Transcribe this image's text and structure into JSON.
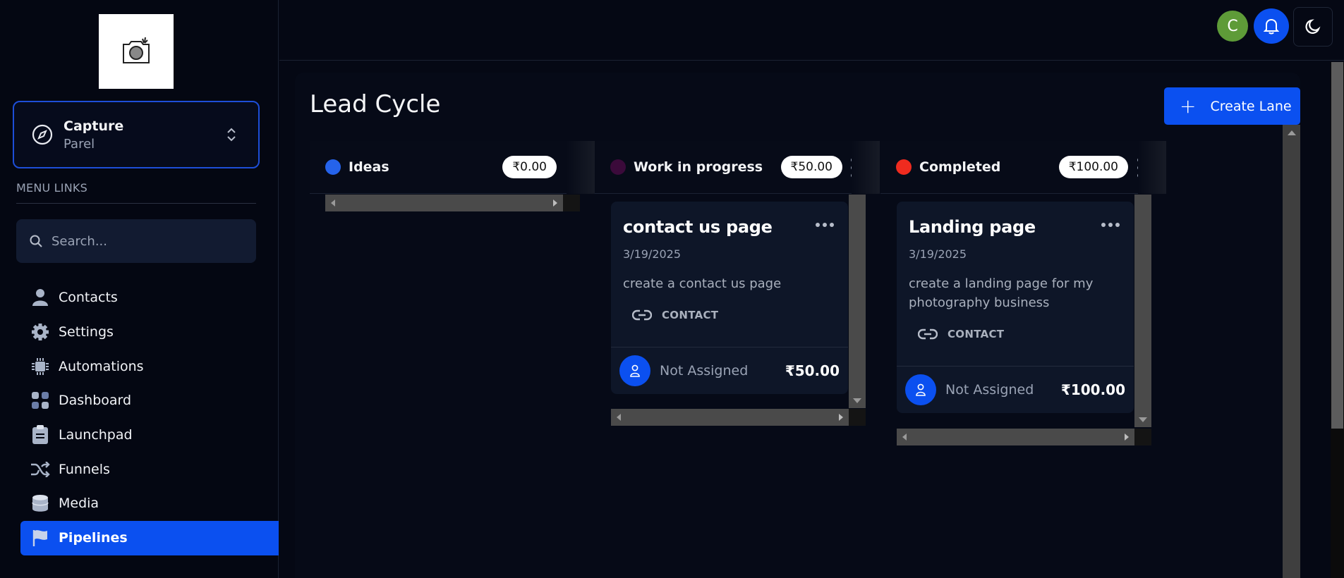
{
  "sidebar": {
    "account": {
      "name": "Capture",
      "location": "Parel"
    },
    "menu_label": "MENU LINKS",
    "search_placeholder": "Search...",
    "items": [
      {
        "label": "Contacts",
        "icon": "user-icon"
      },
      {
        "label": "Settings",
        "icon": "gear-icon"
      },
      {
        "label": "Automations",
        "icon": "chip-icon"
      },
      {
        "label": "Dashboard",
        "icon": "grid-icon"
      },
      {
        "label": "Launchpad",
        "icon": "clipboard-icon"
      },
      {
        "label": "Funnels",
        "icon": "shuffle-icon"
      },
      {
        "label": "Media",
        "icon": "database-icon"
      },
      {
        "label": "Pipelines",
        "icon": "flag-icon",
        "active": true
      }
    ]
  },
  "topbar": {
    "avatar_initial": "C"
  },
  "main": {
    "title": "Lead Cycle",
    "create_button": "Create Lane",
    "lanes": [
      {
        "name": "Ideas",
        "amount": "₹0.00",
        "color": "#2563eb",
        "cards": []
      },
      {
        "name": "Work in progress",
        "amount": "₹50.00",
        "color": "#3b0a3a",
        "cards": [
          {
            "title": "contact us page",
            "date": "3/19/2025",
            "description": "create a contact us page",
            "tag": "CONTACT",
            "assignee": "Not Assigned",
            "amount": "₹50.00"
          }
        ]
      },
      {
        "name": "Completed",
        "amount": "₹100.00",
        "color": "#ef2b1f",
        "cards": [
          {
            "title": "Landing page",
            "date": "3/19/2025",
            "description": "create a landing page for my photography business",
            "tag": "CONTACT",
            "assignee": "Not Assigned",
            "amount": "₹100.00"
          }
        ]
      }
    ]
  }
}
